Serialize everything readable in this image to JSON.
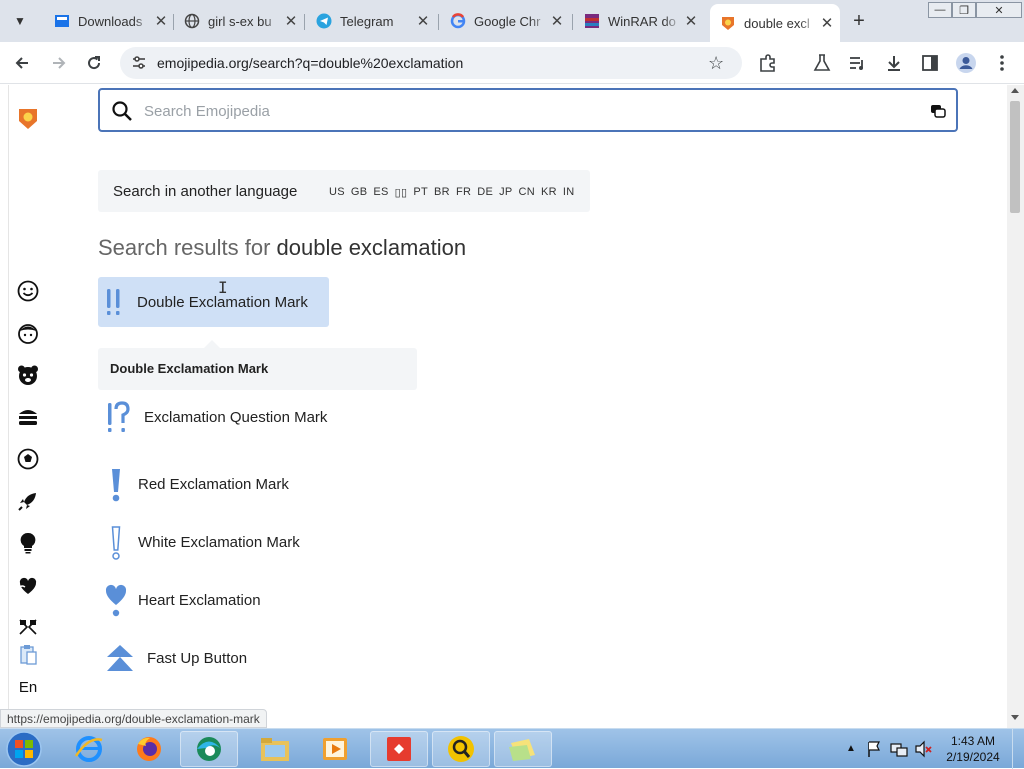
{
  "browser": {
    "tabs": [
      {
        "title": "Downloads",
        "icon": "downloads-favicon"
      },
      {
        "title": "girl s-ex bu",
        "icon": "globe-favicon"
      },
      {
        "title": "Telegram",
        "icon": "telegram-favicon"
      },
      {
        "title": "Google Chr",
        "icon": "google-favicon"
      },
      {
        "title": "WinRAR do",
        "icon": "winrar-favicon"
      },
      {
        "title": "double excl",
        "icon": "emojipedia-favicon",
        "active": true
      }
    ],
    "url": "emojipedia.org/search?q=double%20exclamation",
    "status_url": "https://emojipedia.org/double-exclamation-mark"
  },
  "page": {
    "search": {
      "placeholder": "Search Emojipedia",
      "value": ""
    },
    "language": {
      "label": "Search in another language",
      "codes": [
        "US",
        "GB",
        "ES",
        "▯▯",
        "PT",
        "BR",
        "FR",
        "DE",
        "JP",
        "CN",
        "KR",
        "IN"
      ]
    },
    "results_heading": {
      "prefix": "Search results for ",
      "query": "double exclamation"
    },
    "top_hit": {
      "title": "Double Exclamation Mark",
      "glyph": "‼"
    },
    "tooltip": {
      "title": "Double Exclamation Mark"
    },
    "results": [
      {
        "title": "Exclamation Question Mark",
        "glyph": "⁉"
      },
      {
        "title": "Red Exclamation Mark",
        "glyph": "!"
      },
      {
        "title": "White Exclamation Mark",
        "glyph": "!"
      },
      {
        "title": "Heart Exclamation",
        "glyph": "♥"
      },
      {
        "title": "Fast Up Button",
        "glyph": "⏫"
      }
    ],
    "sidebar": {
      "categories": [
        "smileys-icon",
        "people-icon",
        "animals-icon",
        "food-icon",
        "activities-icon",
        "travel-icon",
        "objects-icon",
        "symbols-icon",
        "flags-icon",
        "clipboard-icon"
      ],
      "language_label": "En"
    }
  },
  "taskbar": {
    "time": "1:43 AM",
    "date": "2/19/2024"
  },
  "colors": {
    "accent": "#4b74b8",
    "emoji_blue": "#5a8fd8",
    "hit_bg": "#cfe0f6"
  }
}
